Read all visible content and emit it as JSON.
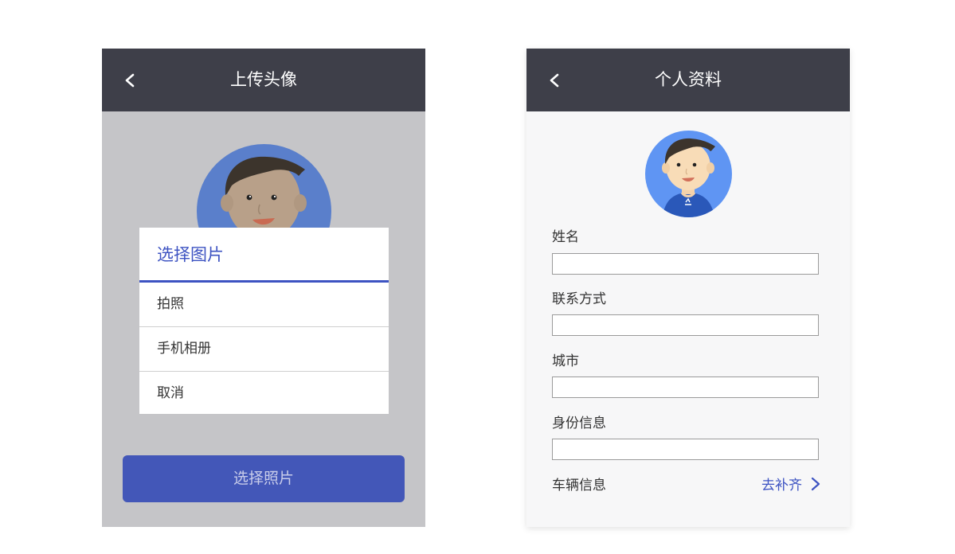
{
  "left_screen": {
    "title": "上传头像",
    "back_glyph": "<",
    "sheet": {
      "title": "选择图片",
      "items": [
        "拍照",
        "手机相册",
        "取消"
      ]
    },
    "primary_button": "选择照片"
  },
  "right_screen": {
    "title": "个人资料",
    "back_glyph": "<",
    "fields": [
      {
        "label": "姓名",
        "value": ""
      },
      {
        "label": "联系方式",
        "value": ""
      },
      {
        "label": "城市",
        "value": ""
      },
      {
        "label": "身份信息",
        "value": ""
      }
    ],
    "vehicle": {
      "label": "车辆信息",
      "link": "去补齐"
    }
  },
  "colors": {
    "header_bg": "#3e3f49",
    "accent": "#3d53c2",
    "button_bg": "#4357b8",
    "overlay_bg": "#c5c5c8",
    "avatar_bg_left": "#5a7fcb",
    "avatar_bg_right": "#5f95f3"
  },
  "icons": {
    "back": "chevron-left-icon",
    "link": "chevron-right-icon",
    "avatar": "avatar-illustration"
  }
}
